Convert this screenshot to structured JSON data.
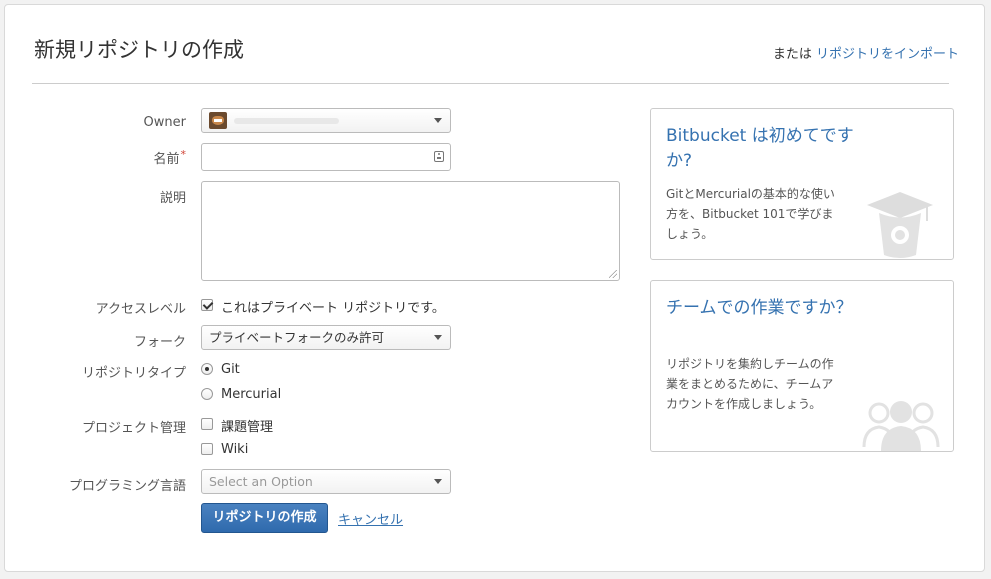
{
  "header": {
    "title": "新規リポジトリの作成",
    "import_prefix": "または",
    "import_link": "リポジトリをインポート"
  },
  "form": {
    "owner_label": "Owner",
    "name_label": "名前",
    "required_mark": "*",
    "name_value": "",
    "description_label": "説明",
    "description_value": "",
    "access_label": "アクセスレベル",
    "private_checkbox_label": "これはプライベート リポジトリです。",
    "private_checked": true,
    "fork_label": "フォーク",
    "fork_value": "プライベートフォークのみ許可",
    "repo_type_label": "リポジトリタイプ",
    "repo_type_git": "Git",
    "repo_type_mercurial": "Mercurial",
    "project_mgmt_label": "プロジェクト管理",
    "issue_tracker_label": "課題管理",
    "wiki_label": "Wiki",
    "language_label": "プログラミング言語",
    "language_placeholder": "Select an Option",
    "create_button": "リポジトリの作成",
    "cancel_link": "キャンセル"
  },
  "cards": {
    "newcomer_title": "Bitbucket は初めてですか?",
    "newcomer_text": "GitとMercurialの基本的な使い方を、Bitbucket 101で学びましょう。",
    "newcomer_icon": "graduation-bucket-icon",
    "team_title": "チームでの作業ですか？",
    "team_text": "リポジトリを集約しチームの作業をまとめるために、チームアカウントを作成しましょう。",
    "team_icon": "team-people-icon"
  },
  "colors": {
    "link": "#3572b0",
    "primary_button": "#3a76b8",
    "required": "#d04437"
  }
}
